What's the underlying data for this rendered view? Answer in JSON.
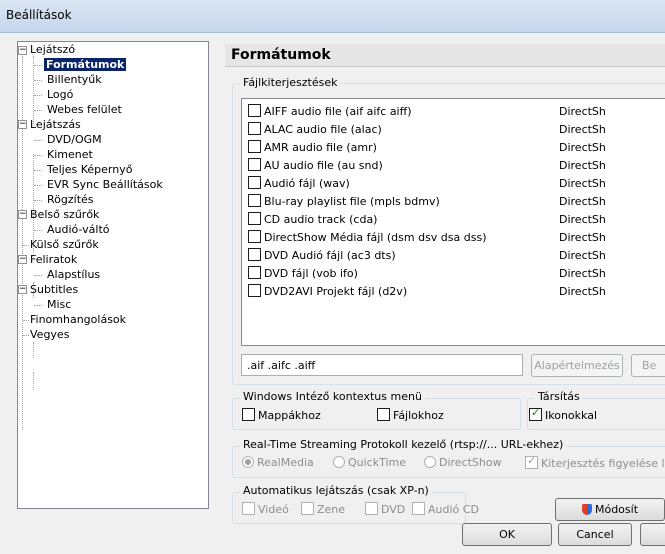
{
  "window": {
    "title": "Beállítások"
  },
  "tree": {
    "items": [
      {
        "label": "Lejátszó"
      },
      {
        "label": "Formátumok"
      },
      {
        "label": "Billentyűk"
      },
      {
        "label": "Logó"
      },
      {
        "label": "Webes felület"
      },
      {
        "label": "Lejátszás"
      },
      {
        "label": "DVD/OGM"
      },
      {
        "label": "Kimenet"
      },
      {
        "label": "Teljes Képernyő"
      },
      {
        "label": "EVR Sync Beállítások"
      },
      {
        "label": "Rögzítés"
      },
      {
        "label": "Belső szűrők"
      },
      {
        "label": "Audió-váltó"
      },
      {
        "label": "Külső szűrők"
      },
      {
        "label": "Feliratok"
      },
      {
        "label": "Alapstílus"
      },
      {
        "label": "Subtitles"
      },
      {
        "label": "Misc"
      },
      {
        "label": "Finomhangolások"
      },
      {
        "label": "Vegyes"
      }
    ]
  },
  "panel": {
    "title": "Formátumok"
  },
  "extensions": {
    "group_label": "Fájlkiterjesztések",
    "rows": [
      {
        "label": "AIFF audio file (aif aifc aiff)",
        "handler": "DirectSh"
      },
      {
        "label": "ALAC audio file (alac)",
        "handler": "DirectSh"
      },
      {
        "label": "AMR audio file (amr)",
        "handler": "DirectSh"
      },
      {
        "label": "AU audio file (au snd)",
        "handler": "DirectSh"
      },
      {
        "label": "Audió fájl (wav)",
        "handler": "DirectSh"
      },
      {
        "label": "Blu-ray playlist file (mpls bdmv)",
        "handler": "DirectSh"
      },
      {
        "label": "CD audio track (cda)",
        "handler": "DirectSh"
      },
      {
        "label": "DirectShow Média fájl (dsm dsv dsa dss)",
        "handler": "DirectSh"
      },
      {
        "label": "DVD Audió fájl (ac3 dts)",
        "handler": "DirectSh"
      },
      {
        "label": "DVD fájl (vob ifo)",
        "handler": "DirectSh"
      },
      {
        "label": "DVD2AVI Projekt fájl (d2v)",
        "handler": "DirectSh"
      }
    ],
    "ext_value": ".aif .aifc .aiff",
    "default_btn": "Alapértelmezés",
    "second_btn": "Be"
  },
  "explorer": {
    "group_label": "Windows Intéző kontextus menü",
    "folders": "Mappákhoz",
    "files": "Fájlokhoz"
  },
  "assoc": {
    "group_label": "Társítás",
    "icons": "Ikonokkal"
  },
  "rtsp": {
    "group_label": "Real-Time Streaming Protokoll kezelő (rtsp://... URL-ekhez)",
    "realmedia": "RealMedia",
    "quicktime": "QuickTime",
    "directshow": "DirectShow",
    "check_ext": "Kiterjesztés figyelése l"
  },
  "autoplay": {
    "group_label": "Automatikus lejátszás (csak XP-n)",
    "video": "Videó",
    "music": "Zene",
    "dvd": "DVD",
    "audiocd": "Audió CD",
    "modify_btn": "Módosít"
  },
  "footer": {
    "ok": "OK",
    "cancel": "Cancel"
  }
}
